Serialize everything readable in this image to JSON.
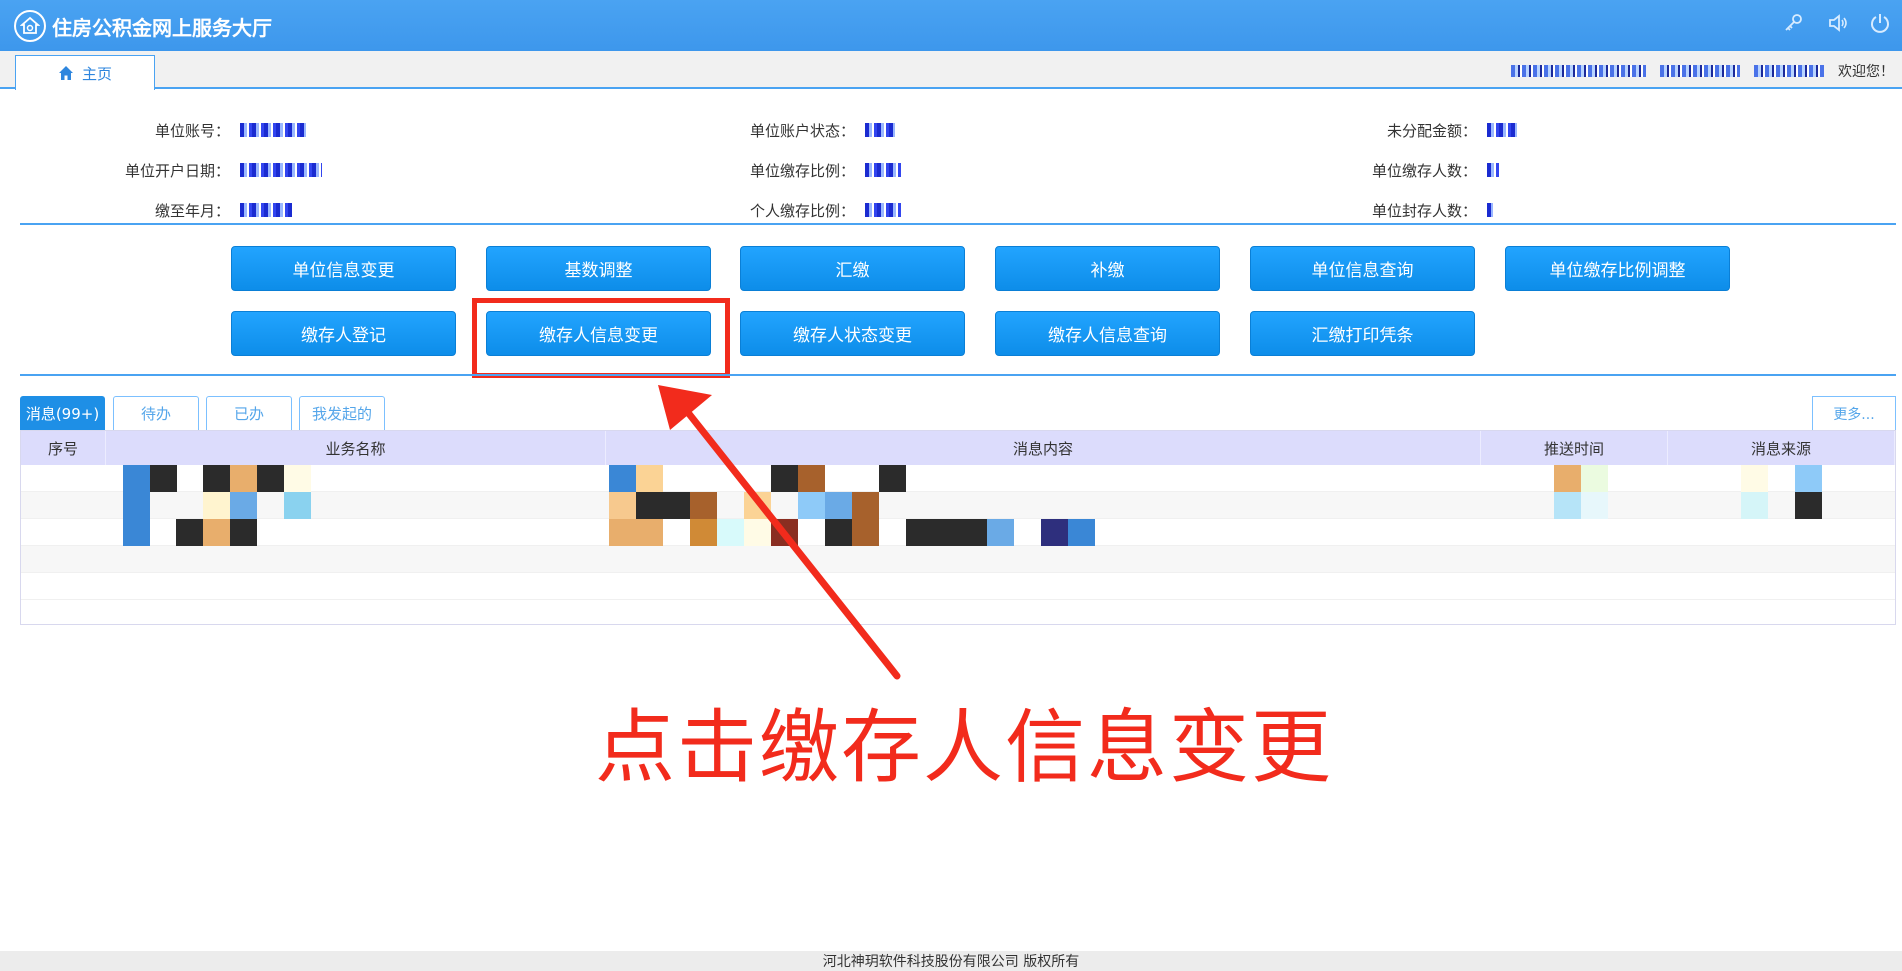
{
  "header": {
    "title": "住房公积金网上服务大厅",
    "icons": [
      "key-icon",
      "speaker-icon",
      "power-icon"
    ]
  },
  "tabs": {
    "home": "主页"
  },
  "user": {
    "welcome": "欢迎您！"
  },
  "info": {
    "col1": [
      {
        "label": "单位账号："
      },
      {
        "label": "单位开户日期："
      },
      {
        "label": "缴至年月："
      }
    ],
    "col2": [
      {
        "label": "单位账户状态："
      },
      {
        "label": "单位缴存比例："
      },
      {
        "label": "个人缴存比例："
      }
    ],
    "col3": [
      {
        "label": "未分配金额："
      },
      {
        "label": "单位缴存人数："
      },
      {
        "label": "单位封存人数："
      }
    ]
  },
  "actions": {
    "row1": [
      "单位信息变更",
      "基数调整",
      "汇缴",
      "补缴",
      "单位信息查询",
      "单位缴存比例调整"
    ],
    "row2": [
      "缴存人登记",
      "缴存人信息变更",
      "缴存人状态变更",
      "缴存人信息查询",
      "汇缴打印凭条"
    ]
  },
  "messages": {
    "tabs": [
      "消息(99+)",
      "待办",
      "已办",
      "我发起的"
    ],
    "more": "更多...",
    "columns": [
      "序号",
      "业务名称",
      "消息内容",
      "推送时间",
      "消息来源"
    ]
  },
  "annotation": "点击缴存人信息变更",
  "footer": "河北神玥软件科技股份有限公司 版权所有",
  "colors": {
    "accent": "#4aa3f2",
    "button": "#1a95ee",
    "annotation": "#f22b1c"
  }
}
